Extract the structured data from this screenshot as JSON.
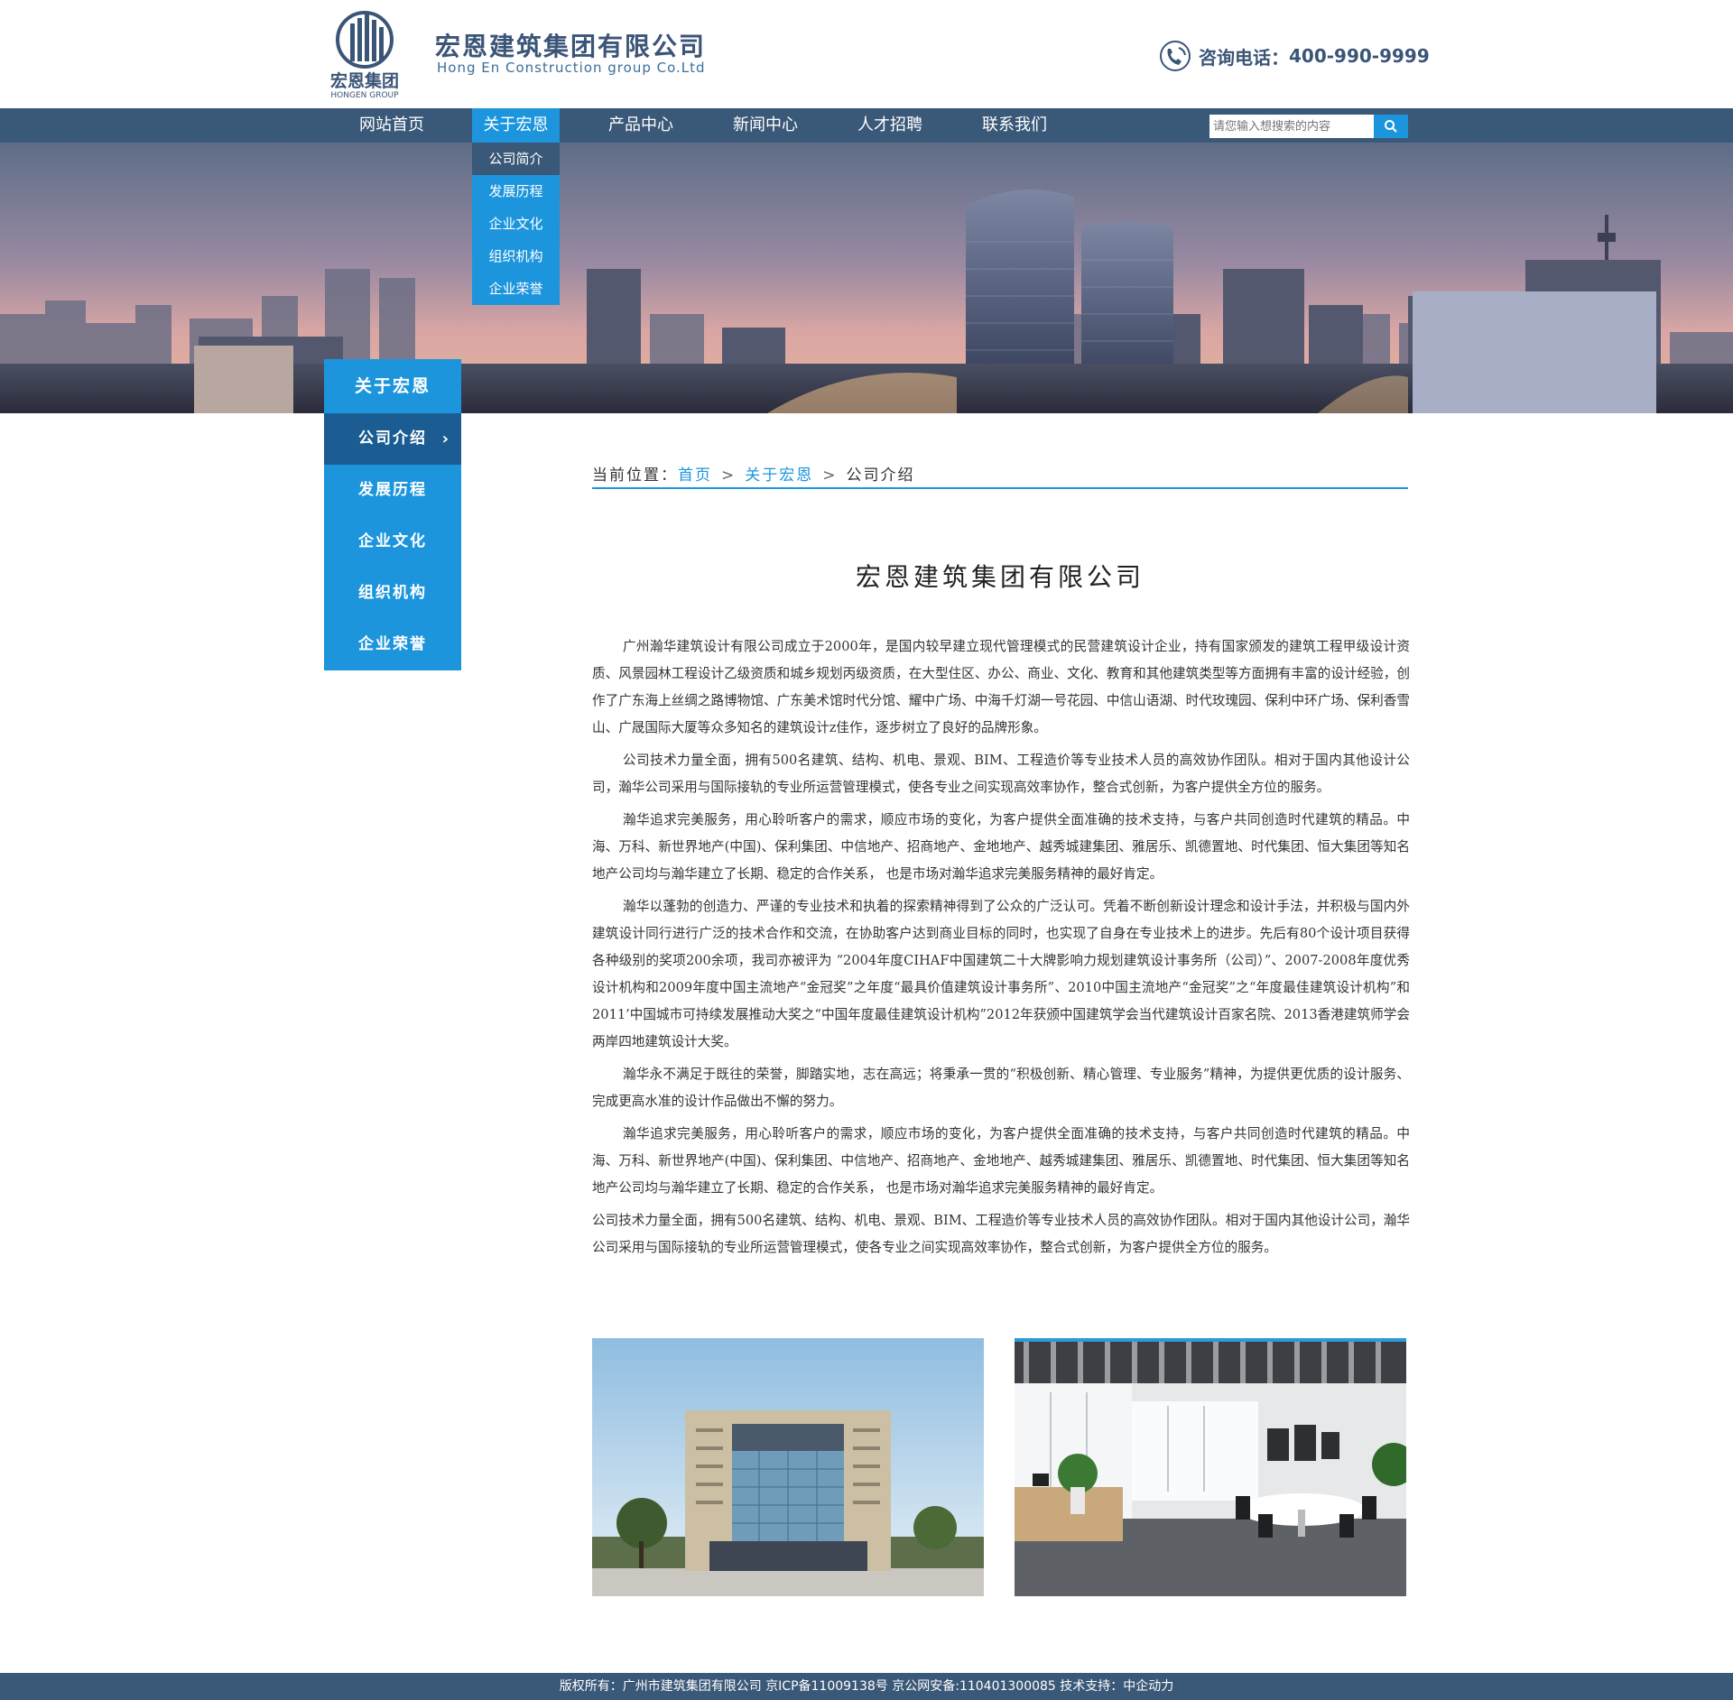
{
  "header": {
    "logo_cn": "宏恩集团",
    "logo_en": "HONGEN GROUP",
    "company_cn": "宏恩建筑集团有限公司",
    "company_en": "Hong En Construction group Co.Ltd",
    "phone_label": "咨询电话：",
    "phone_number": "400-990-9999"
  },
  "nav": {
    "items": [
      "网站首页",
      "关于宏恩",
      "产品中心",
      "新闻中心",
      "人才招聘",
      "联系我们"
    ],
    "active_index": 1,
    "search_placeholder": "请您输入想搜索的内容"
  },
  "dropdown": {
    "items": [
      "公司简介",
      "发展历程",
      "企业文化",
      "组织机构",
      "企业荣誉"
    ],
    "active_index": 0
  },
  "side": {
    "heading": "关于宏恩",
    "items": [
      "公司介绍",
      "发展历程",
      "企业文化",
      "组织机构",
      "企业荣誉"
    ],
    "active_index": 0
  },
  "breadcrumb": {
    "prefix": "当前位置：",
    "home": "首页",
    "section": "关于宏恩",
    "current": "公司介绍"
  },
  "article": {
    "title": "宏恩建筑集团有限公司",
    "paragraphs": [
      "广州瀚华建筑设计有限公司成立于2000年，是国内较早建立现代管理模式的民营建筑设计企业，持有国家颁发的建筑工程甲级设计资质、风景园林工程设计乙级资质和城乡规划丙级资质，在大型住区、办公、商业、文化、教育和其他建筑类型等方面拥有丰富的设计经验，创作了广东海上丝绸之路博物馆、广东美术馆时代分馆、耀中广场、中海千灯湖一号花园、中信山语湖、时代玫瑰园、保利中环广场、保利香雪山、广晟国际大厦等众多知名的建筑设计z佳作，逐步树立了良好的品牌形象。",
      "公司技术力量全面，拥有500名建筑、结构、机电、景观、BIM、工程造价等专业技术人员的高效协作团队。相对于国内其他设计公司，瀚华公司采用与国际接轨的专业所运营管理模式，使各专业之间实现高效率协作，整合式创新，为客户提供全方位的服务。",
      "瀚华追求完美服务，用心聆听客户的需求，顺应市场的变化，为客户提供全面准确的技术支持，与客户共同创造时代建筑的精品。中海、万科、新世界地产(中国)、保利集团、中信地产、招商地产、金地地产、越秀城建集团、雅居乐、凯德置地、时代集团、恒大集团等知名地产公司均与瀚华建立了长期、稳定的合作关系， 也是市场对瀚华追求完美服务精神的最好肯定。",
      "瀚华以蓬勃的创造力、严谨的专业技术和执着的探索精神得到了公众的广泛认可。凭着不断创新设计理念和设计手法，并积极与国内外建筑设计同行进行广泛的技术合作和交流，在协助客户达到商业目标的同时，也实现了自身在专业技术上的进步。先后有80个设计项目获得各种级别的奖项200余项，我司亦被评为 “2004年度CIHAF中国建筑二十大牌影响力规划建筑设计事务所（公司）”、2007-2008年度优秀设计机构和2009年度中国主流地产“金冠奖”之年度“最具价值建筑设计事务所”、2010中国主流地产“金冠奖”之“年度最佳建筑设计机构”和2011’中国城市可持续发展推动大奖之“中国年度最佳建筑设计机构”2012年获颁中国建筑学会当代建筑设计百家名院、2013香港建筑师学会两岸四地建筑设计大奖。",
      "瀚华永不满足于既往的荣誉，脚踏实地，志在高远；将秉承一贯的“积极创新、精心管理、专业服务”精神，为提供更优质的设计服务、完成更高水准的设计作品做出不懈的努力。",
      "瀚华追求完美服务，用心聆听客户的需求，顺应市场的变化，为客户提供全面准确的技术支持，与客户共同创造时代建筑的精品。中海、万科、新世界地产(中国)、保利集团、中信地产、招商地产、金地地产、越秀城建集团、雅居乐、凯德置地、时代集团、恒大集团等知名地产公司均与瀚华建立了长期、稳定的合作关系， 也是市场对瀚华追求完美服务精神的最好肯定。",
      "公司技术力量全面，拥有500名建筑、结构、机电、景观、BIM、工程造价等专业技术人员的高效协作团队。相对于国内其他设计公司，瀚华公司采用与国际接轨的专业所运营管理模式，使各专业之间实现高效率协作，整合式创新，为客户提供全方位的服务。"
    ]
  },
  "footer": {
    "text": "版权所有：广州市建筑集团有限公司 京ICP备11009138号 京公网安备:110401300085 技术支持：中企动力"
  },
  "colors": {
    "nav_bg": "#3a5878",
    "accent": "#1d95dd",
    "side_active": "#1b5d92"
  }
}
